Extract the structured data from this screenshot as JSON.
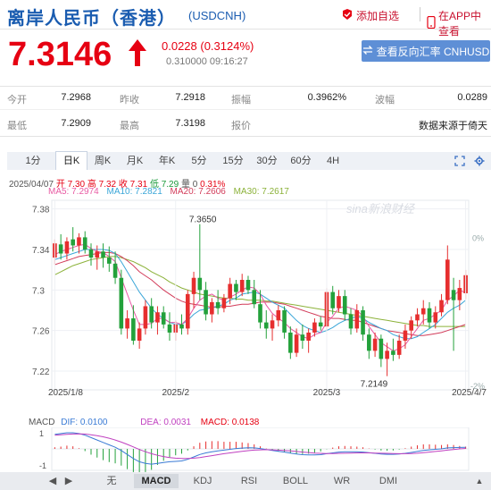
{
  "header": {
    "title": "离岸人民币（香港）",
    "code": "(USDCNH)",
    "add_watchlist": "添加自选",
    "app_view": "在APP中查看"
  },
  "quote": {
    "price": "7.3146",
    "change": "0.0228 (0.3124%)",
    "sub": "0.310000 09:16:27",
    "reverse_button": "查看反向汇率 CNHUSD"
  },
  "stats": {
    "row1": [
      {
        "label": "今开",
        "value": "7.2968"
      },
      {
        "label": "昨收",
        "value": "7.2918"
      },
      {
        "label": "振幅",
        "value": "0.3962%"
      },
      {
        "label": "波幅",
        "value": "0.0289"
      }
    ],
    "row2": [
      {
        "label": "最低",
        "value": "7.2909"
      },
      {
        "label": "最高",
        "value": "7.3198"
      },
      {
        "label": "报价",
        "value": ""
      },
      {
        "label": "",
        "value": "数据来源于倚天"
      }
    ]
  },
  "period_tabs": [
    "1分",
    "日K",
    "周K",
    "月K",
    "年K",
    "5分",
    "15分",
    "30分",
    "60分",
    "4H"
  ],
  "active_period": "日K",
  "legend_line1": {
    "date": "2025/04/07",
    "open": "开 7.30",
    "high": "高 7.32",
    "close": "收 7.31",
    "low": "低 7.29",
    "vol": "量 0",
    "pct": "0.31%"
  },
  "ma_legend": [
    {
      "name": "MA5: 7.2974",
      "color": "#e85aa3"
    },
    {
      "name": "MA10: 7.2821",
      "color": "#3aa6d8"
    },
    {
      "name": "MA20: 7.2606",
      "color": "#d23c5a"
    },
    {
      "name": "MA30: 7.2617",
      "color": "#8cb23a"
    }
  ],
  "watermark": "sina新浪财经",
  "chart_data": {
    "type": "candlestick",
    "y_ticks": [
      "7.38",
      "7.34",
      "7.3",
      "7.26",
      "7.22"
    ],
    "pct_ticks": [
      "0%",
      "-2%"
    ],
    "x_ticks": [
      "2025/1/8",
      "2025/2",
      "2025/3",
      "2025/4/7"
    ],
    "ylim": [
      7.205,
      7.385
    ],
    "annotations": {
      "high": "7.3650",
      "low": "7.2149"
    },
    "colors": {
      "up": "#e62e2e",
      "down": "#23a13b"
    },
    "candles": [
      {
        "o": 7.332,
        "h": 7.35,
        "l": 7.325,
        "c": 7.346
      },
      {
        "o": 7.345,
        "h": 7.355,
        "l": 7.33,
        "c": 7.336
      },
      {
        "o": 7.336,
        "h": 7.352,
        "l": 7.33,
        "c": 7.348
      },
      {
        "o": 7.35,
        "h": 7.362,
        "l": 7.338,
        "c": 7.344
      },
      {
        "o": 7.344,
        "h": 7.356,
        "l": 7.336,
        "c": 7.352
      },
      {
        "o": 7.352,
        "h": 7.358,
        "l": 7.336,
        "c": 7.34
      },
      {
        "o": 7.34,
        "h": 7.346,
        "l": 7.324,
        "c": 7.332
      },
      {
        "o": 7.332,
        "h": 7.344,
        "l": 7.32,
        "c": 7.338
      },
      {
        "o": 7.338,
        "h": 7.346,
        "l": 7.322,
        "c": 7.332
      },
      {
        "o": 7.332,
        "h": 7.343,
        "l": 7.318,
        "c": 7.326
      },
      {
        "o": 7.326,
        "h": 7.338,
        "l": 7.306,
        "c": 7.312
      },
      {
        "o": 7.312,
        "h": 7.32,
        "l": 7.256,
        "c": 7.262
      },
      {
        "o": 7.262,
        "h": 7.28,
        "l": 7.252,
        "c": 7.272
      },
      {
        "o": 7.272,
        "h": 7.285,
        "l": 7.246,
        "c": 7.25
      },
      {
        "o": 7.25,
        "h": 7.268,
        "l": 7.242,
        "c": 7.262
      },
      {
        "o": 7.262,
        "h": 7.29,
        "l": 7.256,
        "c": 7.284
      },
      {
        "o": 7.284,
        "h": 7.292,
        "l": 7.262,
        "c": 7.268
      },
      {
        "o": 7.268,
        "h": 7.284,
        "l": 7.256,
        "c": 7.278
      },
      {
        "o": 7.278,
        "h": 7.284,
        "l": 7.262,
        "c": 7.266
      },
      {
        "o": 7.266,
        "h": 7.278,
        "l": 7.25,
        "c": 7.258
      },
      {
        "o": 7.258,
        "h": 7.27,
        "l": 7.25,
        "c": 7.266
      },
      {
        "o": 7.266,
        "h": 7.276,
        "l": 7.256,
        "c": 7.262
      },
      {
        "o": 7.262,
        "h": 7.3,
        "l": 7.256,
        "c": 7.296
      },
      {
        "o": 7.296,
        "h": 7.318,
        "l": 7.282,
        "c": 7.312
      },
      {
        "o": 7.312,
        "h": 7.365,
        "l": 7.29,
        "c": 7.3
      },
      {
        "o": 7.3,
        "h": 7.308,
        "l": 7.27,
        "c": 7.276
      },
      {
        "o": 7.276,
        "h": 7.292,
        "l": 7.268,
        "c": 7.288
      },
      {
        "o": 7.288,
        "h": 7.3,
        "l": 7.276,
        "c": 7.282
      },
      {
        "o": 7.282,
        "h": 7.296,
        "l": 7.278,
        "c": 7.292
      },
      {
        "o": 7.292,
        "h": 7.312,
        "l": 7.286,
        "c": 7.306
      },
      {
        "o": 7.306,
        "h": 7.31,
        "l": 7.29,
        "c": 7.298
      },
      {
        "o": 7.298,
        "h": 7.316,
        "l": 7.294,
        "c": 7.31
      },
      {
        "o": 7.31,
        "h": 7.314,
        "l": 7.296,
        "c": 7.3
      },
      {
        "o": 7.3,
        "h": 7.31,
        "l": 7.282,
        "c": 7.286
      },
      {
        "o": 7.286,
        "h": 7.3,
        "l": 7.262,
        "c": 7.268
      },
      {
        "o": 7.268,
        "h": 7.28,
        "l": 7.252,
        "c": 7.262
      },
      {
        "o": 7.262,
        "h": 7.276,
        "l": 7.25,
        "c": 7.27
      },
      {
        "o": 7.27,
        "h": 7.285,
        "l": 7.264,
        "c": 7.28
      },
      {
        "o": 7.28,
        "h": 7.284,
        "l": 7.252,
        "c": 7.258
      },
      {
        "o": 7.258,
        "h": 7.264,
        "l": 7.232,
        "c": 7.238
      },
      {
        "o": 7.238,
        "h": 7.262,
        "l": 7.234,
        "c": 7.256
      },
      {
        "o": 7.256,
        "h": 7.266,
        "l": 7.242,
        "c": 7.25
      },
      {
        "o": 7.25,
        "h": 7.262,
        "l": 7.238,
        "c": 7.258
      },
      {
        "o": 7.258,
        "h": 7.272,
        "l": 7.254,
        "c": 7.268
      },
      {
        "o": 7.268,
        "h": 7.274,
        "l": 7.26,
        "c": 7.264
      },
      {
        "o": 7.264,
        "h": 7.302,
        "l": 7.26,
        "c": 7.298
      },
      {
        "o": 7.298,
        "h": 7.304,
        "l": 7.276,
        "c": 7.282
      },
      {
        "o": 7.282,
        "h": 7.3,
        "l": 7.278,
        "c": 7.294
      },
      {
        "o": 7.294,
        "h": 7.3,
        "l": 7.27,
        "c": 7.276
      },
      {
        "o": 7.276,
        "h": 7.282,
        "l": 7.256,
        "c": 7.262
      },
      {
        "o": 7.262,
        "h": 7.286,
        "l": 7.258,
        "c": 7.28
      },
      {
        "o": 7.28,
        "h": 7.284,
        "l": 7.25,
        "c": 7.256
      },
      {
        "o": 7.256,
        "h": 7.262,
        "l": 7.232,
        "c": 7.24
      },
      {
        "o": 7.24,
        "h": 7.258,
        "l": 7.234,
        "c": 7.252
      },
      {
        "o": 7.252,
        "h": 7.256,
        "l": 7.224,
        "c": 7.232
      },
      {
        "o": 7.232,
        "h": 7.248,
        "l": 7.215,
        "c": 7.24
      },
      {
        "o": 7.24,
        "h": 7.252,
        "l": 7.23,
        "c": 7.236
      },
      {
        "o": 7.236,
        "h": 7.256,
        "l": 7.232,
        "c": 7.25
      },
      {
        "o": 7.25,
        "h": 7.266,
        "l": 7.242,
        "c": 7.26
      },
      {
        "o": 7.26,
        "h": 7.274,
        "l": 7.252,
        "c": 7.27
      },
      {
        "o": 7.27,
        "h": 7.282,
        "l": 7.264,
        "c": 7.276
      },
      {
        "o": 7.276,
        "h": 7.29,
        "l": 7.266,
        "c": 7.282
      },
      {
        "o": 7.282,
        "h": 7.288,
        "l": 7.262,
        "c": 7.268
      },
      {
        "o": 7.268,
        "h": 7.284,
        "l": 7.262,
        "c": 7.278
      },
      {
        "o": 7.278,
        "h": 7.296,
        "l": 7.274,
        "c": 7.29
      },
      {
        "o": 7.29,
        "h": 7.344,
        "l": 7.286,
        "c": 7.33
      },
      {
        "o": 7.3,
        "h": 7.312,
        "l": 7.24,
        "c": 7.29
      },
      {
        "o": 7.29,
        "h": 7.31,
        "l": 7.28,
        "c": 7.302
      },
      {
        "o": 7.2968,
        "h": 7.3198,
        "l": 7.2909,
        "c": 7.3146
      }
    ],
    "ma5": [
      7.335,
      7.338,
      7.34,
      7.342,
      7.344,
      7.345,
      7.341,
      7.338,
      7.337,
      7.333,
      7.328,
      7.312,
      7.296,
      7.28,
      7.266,
      7.266,
      7.267,
      7.272,
      7.272,
      7.268,
      7.268,
      7.266,
      7.272,
      7.282,
      7.29,
      7.294,
      7.296,
      7.292,
      7.29,
      7.293,
      7.296,
      7.3,
      7.303,
      7.302,
      7.296,
      7.285,
      7.277,
      7.272,
      7.268,
      7.262,
      7.258,
      7.254,
      7.252,
      7.256,
      7.258,
      7.268,
      7.274,
      7.282,
      7.284,
      7.282,
      7.28,
      7.274,
      7.264,
      7.256,
      7.248,
      7.244,
      7.24,
      7.242,
      7.246,
      7.254,
      7.262,
      7.27,
      7.272,
      7.276,
      7.28,
      7.29,
      7.294,
      7.3,
      7.297
    ],
    "ma10": [
      7.33,
      7.332,
      7.334,
      7.336,
      7.338,
      7.34,
      7.34,
      7.34,
      7.34,
      7.339,
      7.336,
      7.328,
      7.318,
      7.308,
      7.298,
      7.29,
      7.282,
      7.276,
      7.272,
      7.268,
      7.266,
      7.266,
      7.27,
      7.276,
      7.28,
      7.281,
      7.283,
      7.284,
      7.286,
      7.29,
      7.292,
      7.296,
      7.297,
      7.298,
      7.296,
      7.292,
      7.288,
      7.285,
      7.282,
      7.276,
      7.27,
      7.265,
      7.262,
      7.26,
      7.258,
      7.26,
      7.263,
      7.267,
      7.27,
      7.272,
      7.274,
      7.272,
      7.268,
      7.265,
      7.262,
      7.26,
      7.256,
      7.254,
      7.252,
      7.252,
      7.254,
      7.258,
      7.262,
      7.266,
      7.272,
      7.278,
      7.282,
      7.285,
      7.29
    ],
    "ma20": [
      7.325,
      7.327,
      7.329,
      7.331,
      7.333,
      7.334,
      7.335,
      7.336,
      7.337,
      7.337,
      7.336,
      7.333,
      7.329,
      7.324,
      7.318,
      7.314,
      7.31,
      7.305,
      7.3,
      7.296,
      7.292,
      7.289,
      7.287,
      7.286,
      7.285,
      7.284,
      7.283,
      7.283,
      7.284,
      7.284,
      7.285,
      7.286,
      7.286,
      7.287,
      7.288,
      7.288,
      7.288,
      7.287,
      7.286,
      7.284,
      7.282,
      7.28,
      7.278,
      7.276,
      7.274,
      7.273,
      7.272,
      7.272,
      7.271,
      7.27,
      7.27,
      7.268,
      7.266,
      7.264,
      7.262,
      7.26,
      7.259,
      7.258,
      7.257,
      7.256,
      7.255,
      7.255,
      7.256,
      7.257,
      7.258,
      7.26,
      7.262,
      7.264,
      7.266
    ],
    "ma30": [
      7.315,
      7.318,
      7.321,
      7.324,
      7.326,
      7.328,
      7.33,
      7.331,
      7.332,
      7.333,
      7.333,
      7.332,
      7.33,
      7.328,
      7.325,
      7.322,
      7.318,
      7.315,
      7.312,
      7.308,
      7.305,
      7.302,
      7.3,
      7.298,
      7.296,
      7.295,
      7.294,
      7.293,
      7.292,
      7.292,
      7.291,
      7.291,
      7.29,
      7.29,
      7.29,
      7.289,
      7.289,
      7.288,
      7.287,
      7.286,
      7.285,
      7.284,
      7.283,
      7.282,
      7.281,
      7.28,
      7.279,
      7.278,
      7.277,
      7.276,
      7.275,
      7.274,
      7.273,
      7.272,
      7.271,
      7.27,
      7.269,
      7.268,
      7.267,
      7.266,
      7.265,
      7.265,
      7.264,
      7.264,
      7.264,
      7.264,
      7.264,
      7.264,
      7.264
    ]
  },
  "macd": {
    "label": "MACD",
    "dif": "DIF: 0.0100",
    "dea": "DEA: 0.0031",
    "macd": "MACD: 0.0138",
    "dif_color": "#3a7bd5",
    "dea_color": "#c040c0",
    "y_ticks": [
      "1",
      "-1"
    ],
    "dif_series": [
      0.9,
      0.95,
      1.0,
      1.0,
      0.95,
      0.85,
      0.7,
      0.55,
      0.4,
      0.25,
      0.1,
      -0.1,
      -0.35,
      -0.6,
      -0.8,
      -0.9,
      -0.95,
      -0.9,
      -0.85,
      -0.8,
      -0.78,
      -0.75,
      -0.65,
      -0.5,
      -0.35,
      -0.25,
      -0.18,
      -0.12,
      -0.08,
      -0.03,
      0.02,
      0.05,
      0.07,
      0.06,
      0.02,
      -0.04,
      -0.1,
      -0.15,
      -0.2,
      -0.26,
      -0.32,
      -0.36,
      -0.38,
      -0.38,
      -0.36,
      -0.3,
      -0.25,
      -0.2,
      -0.18,
      -0.18,
      -0.18,
      -0.2,
      -0.24,
      -0.28,
      -0.32,
      -0.34,
      -0.34,
      -0.32,
      -0.28,
      -0.22,
      -0.16,
      -0.1,
      -0.06,
      -0.03,
      0.0,
      0.06,
      0.08,
      0.09,
      0.1
    ],
    "dea_series": [
      0.85,
      0.88,
      0.9,
      0.92,
      0.93,
      0.92,
      0.88,
      0.82,
      0.75,
      0.66,
      0.55,
      0.42,
      0.28,
      0.12,
      -0.04,
      -0.18,
      -0.3,
      -0.4,
      -0.48,
      -0.54,
      -0.58,
      -0.6,
      -0.6,
      -0.58,
      -0.54,
      -0.48,
      -0.42,
      -0.36,
      -0.3,
      -0.25,
      -0.2,
      -0.15,
      -0.11,
      -0.08,
      -0.06,
      -0.05,
      -0.06,
      -0.08,
      -0.1,
      -0.13,
      -0.16,
      -0.2,
      -0.23,
      -0.26,
      -0.28,
      -0.29,
      -0.29,
      -0.28,
      -0.27,
      -0.26,
      -0.25,
      -0.25,
      -0.25,
      -0.26,
      -0.27,
      -0.28,
      -0.29,
      -0.3,
      -0.3,
      -0.29,
      -0.27,
      -0.24,
      -0.2,
      -0.16,
      -0.12,
      -0.08,
      -0.04,
      0.0,
      0.03
    ]
  },
  "indicator_tabs": [
    "无",
    "MACD",
    "KDJ",
    "RSI",
    "BOLL",
    "WR",
    "DMI"
  ],
  "active_indicator": "MACD"
}
